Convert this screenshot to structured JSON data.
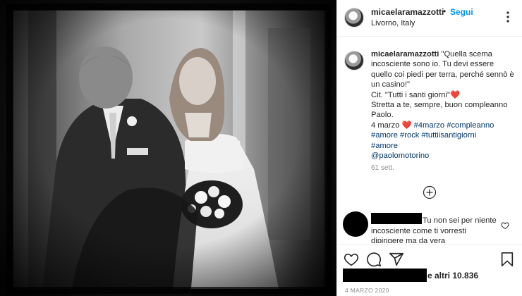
{
  "post": {
    "username": "micaelaramazzotti",
    "separator": "•",
    "follow_label": "Segui",
    "location": "Livorno, Italy",
    "more_icon": "more-options-icon"
  },
  "caption": {
    "username": "micaelaramazzotti",
    "text_1": "\"Quella scema incosciente sono io. Tu devi essere quello coi piedi per terra, perché sennò è un casino!\"",
    "text_2": "Cit. \"Tutti i santi giorni\"",
    "heart": "❤️",
    "text_3": "Stretta a te, sempre, buon compleanno Paolo.",
    "text_4": "4 marzo",
    "hashtags": [
      "#4marzo",
      "#compleanno",
      "#amore",
      "#rock",
      "#tuttiisantigiorni",
      "#amore"
    ],
    "mention": "@paolomotorino",
    "time": "61 sett."
  },
  "load_more_icon": "plus-circle-icon",
  "comment": {
    "text": "Tu non sei per niente incosciente come ti vorresti dipingere ma da vera"
  },
  "actions": {
    "like_icon": "heart-icon",
    "comment_icon": "comment-icon",
    "share_icon": "share-icon",
    "save_icon": "bookmark-icon"
  },
  "likes": {
    "text": "e altri 10.836"
  },
  "date": "4 MARZO 2020",
  "colors": {
    "accent": "#0095f6",
    "hashtag": "#00376b",
    "heart": "#e0245e",
    "muted": "#8e8e8e"
  }
}
